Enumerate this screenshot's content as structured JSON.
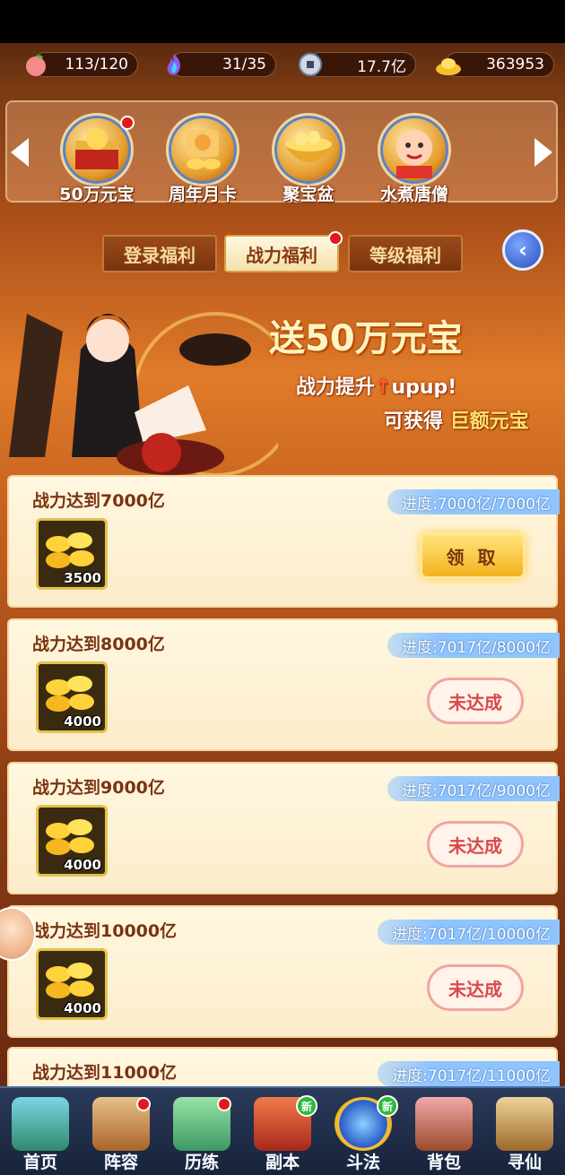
{
  "resources": [
    {
      "icon": "peach-icon",
      "value": "113/120",
      "color": "#f48a8a"
    },
    {
      "icon": "flame-icon",
      "value": "31/35",
      "color": "#8a5cf0"
    },
    {
      "icon": "coin-icon",
      "value": "17.7亿",
      "color": "#8aa8d0"
    },
    {
      "icon": "gold-ingot-icon",
      "value": "363953",
      "color": "#f5c22e"
    }
  ],
  "events": [
    {
      "label": "50万元宝",
      "icon": "treasure-chest-icon",
      "has_dot": true
    },
    {
      "label": "周年月卡",
      "icon": "month-card-icon",
      "has_dot": false
    },
    {
      "label": "聚宝盆",
      "icon": "treasure-bowl-icon",
      "has_dot": false
    },
    {
      "label": "水煮唐僧",
      "icon": "monk-icon",
      "has_dot": false
    }
  ],
  "tabs": [
    {
      "label": "登录福利",
      "active": false,
      "has_dot": false
    },
    {
      "label": "战力福利",
      "active": true,
      "has_dot": true
    },
    {
      "label": "等级福利",
      "active": false,
      "has_dot": false
    }
  ],
  "banner": {
    "title_prefix": "送",
    "title_main": "50万元宝",
    "line1_text": "战力提升",
    "line1_suffix": "upup!",
    "line2_prefix": "可获得",
    "line2_highlight": "巨额元宝"
  },
  "rewards": [
    {
      "title": "战力达到7000亿",
      "progress": "进度:7000亿/7000亿",
      "qty": "3500",
      "button": "领 取",
      "status": "claimable"
    },
    {
      "title": "战力达到8000亿",
      "progress": "进度:7017亿/8000亿",
      "qty": "4000",
      "button": "未达成",
      "status": "unmet"
    },
    {
      "title": "战力达到9000亿",
      "progress": "进度:7017亿/9000亿",
      "qty": "4000",
      "button": "未达成",
      "status": "unmet"
    },
    {
      "title": "战力达到10000亿",
      "progress": "进度:7017亿/10000亿",
      "qty": "4000",
      "button": "未达成",
      "status": "unmet"
    },
    {
      "title": "战力达到11000亿",
      "progress": "进度:7017亿/11000亿",
      "qty": "",
      "button": "",
      "status": "partial"
    }
  ],
  "nav": [
    {
      "label": "首页",
      "icon": "home-icon",
      "dot": false,
      "new": false
    },
    {
      "label": "阵容",
      "icon": "lineup-icon",
      "dot": true,
      "new": false
    },
    {
      "label": "历练",
      "icon": "training-icon",
      "dot": true,
      "new": false
    },
    {
      "label": "副本",
      "icon": "dungeon-icon",
      "dot": false,
      "new": true
    },
    {
      "label": "斗法",
      "icon": "battle-icon",
      "dot": false,
      "new": true
    },
    {
      "label": "背包",
      "icon": "bag-icon",
      "dot": false,
      "new": false
    },
    {
      "label": "寻仙",
      "icon": "seek-immortal-icon",
      "dot": false,
      "new": false
    }
  ],
  "new_badge_text": "新"
}
